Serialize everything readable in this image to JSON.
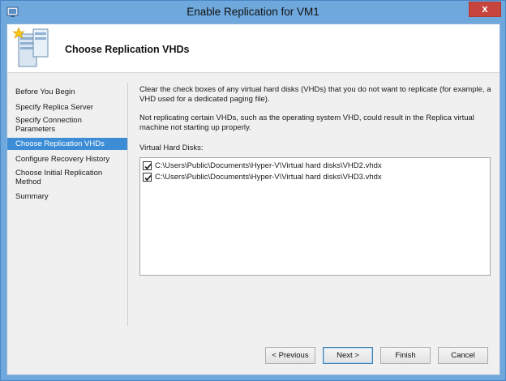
{
  "window": {
    "title": "Enable Replication for VM1",
    "close_glyph": "x"
  },
  "header": {
    "title": "Choose Replication VHDs",
    "icon": "server-wizard-icon"
  },
  "nav": {
    "items": [
      {
        "label": "Before You Begin"
      },
      {
        "label": "Specify Replica Server"
      },
      {
        "label": "Specify Connection Parameters"
      },
      {
        "label": "Choose Replication VHDs",
        "active": true
      },
      {
        "label": "Configure Recovery History"
      },
      {
        "label": "Choose Initial Replication Method"
      },
      {
        "label": "Summary"
      }
    ],
    "active_color": "#3c8dd6"
  },
  "content": {
    "intro": "Clear the check boxes of any virtual hard disks (VHDs) that you do not want to replicate (for example, a VHD used for a dedicated paging file).",
    "warning": "Not replicating certain VHDs, such as the operating system VHD, could result in the Replica virtual machine not starting up properly.",
    "list_label": "Virtual Hard Disks:",
    "vhds": [
      {
        "path": "C:\\Users\\Public\\Documents\\Hyper-V\\Virtual hard disks\\VHD2.vhdx",
        "checked": true
      },
      {
        "path": "C:\\Users\\Public\\Documents\\Hyper-V\\Virtual hard disks\\VHD3.vhdx",
        "checked": true
      }
    ]
  },
  "buttons": {
    "previous": "< Previous",
    "next": "Next >",
    "finish": "Finish",
    "cancel": "Cancel"
  }
}
